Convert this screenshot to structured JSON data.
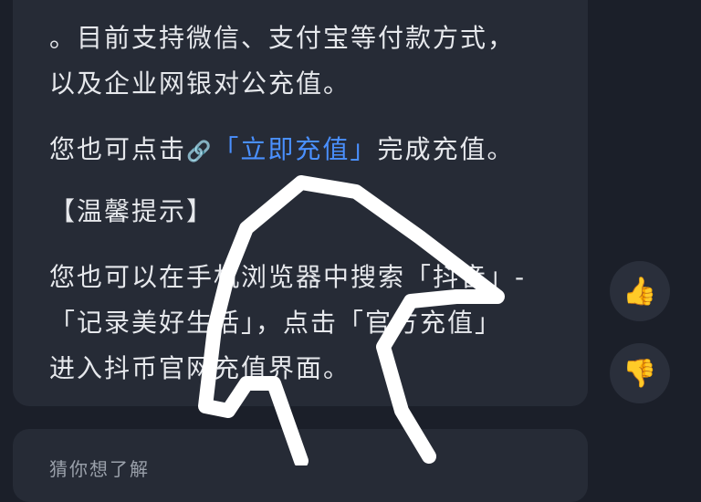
{
  "message": {
    "lines": [
      "。目前支持微信、支付宝等付款方式，",
      "以及企业网银对公充值。",
      "您也可点击",
      "「立即充值」",
      "完成充值。",
      "【温馨提示】",
      "您也可以在手机浏览器中搜索「抖音」-",
      "「记录美好生活」，点击「官方充值」",
      "进入抖币官网充值界面。"
    ],
    "link_icon": "🔗"
  },
  "actions": {
    "like_icon": "👍",
    "dislike_icon": "👎"
  },
  "next_message": {
    "text": "猜你想了解"
  }
}
